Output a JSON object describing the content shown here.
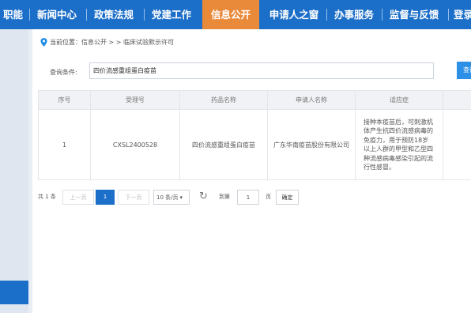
{
  "nav": {
    "items": [
      {
        "label": "职能",
        "active": false
      },
      {
        "label": "新闻中心",
        "active": false
      },
      {
        "label": "政策法规",
        "active": false
      },
      {
        "label": "党建工作",
        "active": false
      },
      {
        "label": "信息公开",
        "active": true
      },
      {
        "label": "申请人之窗",
        "active": false
      },
      {
        "label": "办事服务",
        "active": false
      },
      {
        "label": "监督与反馈",
        "active": false
      },
      {
        "label": "登录",
        "active": false
      }
    ]
  },
  "breadcrumb": {
    "text": "当前位置：信息公开 > > 临床试验默示许可"
  },
  "search": {
    "label": "查询条件:",
    "value": "四价流感重组蛋白疫苗",
    "button_label": "查询"
  },
  "table": {
    "columns": [
      "序号",
      "受理号",
      "药品名称",
      "申请人名称",
      "适应症",
      ""
    ],
    "rows": [
      {
        "index": "1",
        "acceptance_no": "CXSL2400528",
        "drug_name": "四价流感重组蛋白疫苗",
        "applicant": "广东华南疫苗股份有限公司",
        "indication": "接种本疫苗后，可刺激机体产生抗四价流感病毒的免疫力，用于预防18岁以上人群的甲型和乙型四种流感病毒感染引起的流行性感冒。",
        "extra": ""
      }
    ]
  },
  "pagination": {
    "total": "共 1 条",
    "prev": "上一页",
    "current_page": "1",
    "next": "下一页",
    "page_size": "10 条/页",
    "goto_label": "到第",
    "goto_value": "1",
    "page_unit": "页",
    "confirm": "确定"
  },
  "colors": {
    "nav_bg": "#1c6fc9",
    "nav_active": "#e9893a",
    "accent": "#2d8fe6"
  }
}
